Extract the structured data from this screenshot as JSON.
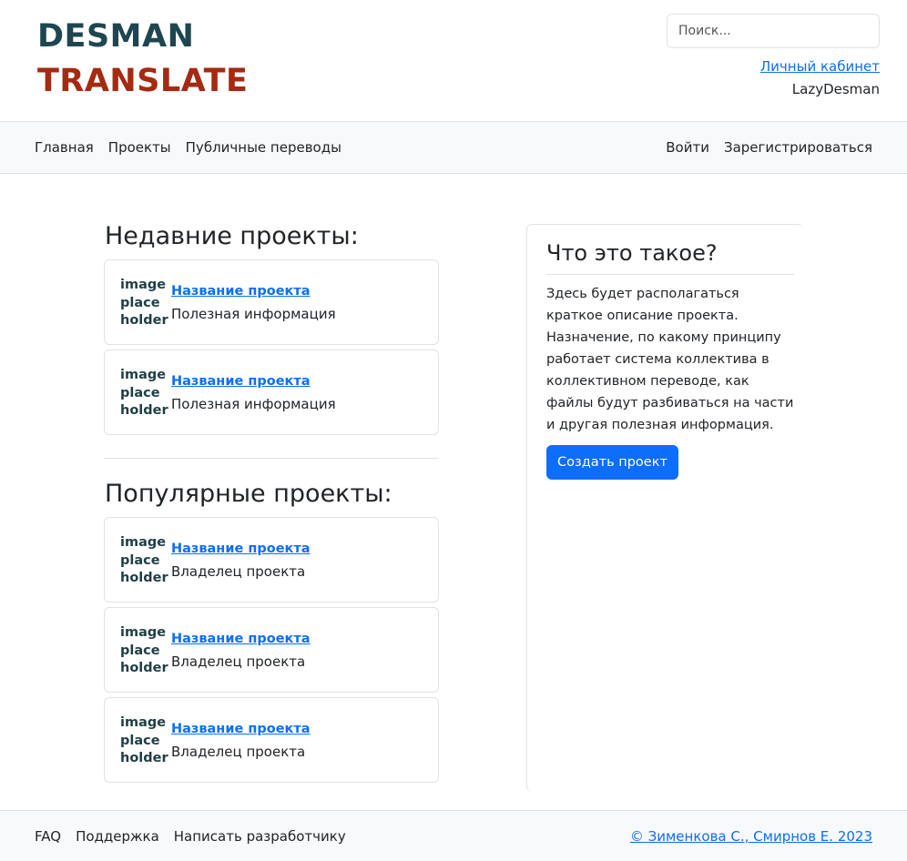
{
  "logo": {
    "line1": "DESMAN",
    "line2": "TRANSLATE"
  },
  "search": {
    "placeholder": "Поиск..."
  },
  "user": {
    "cabinet_link": "Личный кабинет",
    "username": "LazyDesman"
  },
  "nav": {
    "left": [
      "Главная",
      "Проекты",
      "Публичные переводы"
    ],
    "right": [
      "Войти",
      "Зарегистрироваться"
    ]
  },
  "recent": {
    "title": "Недавние проекты:",
    "items": [
      {
        "image": "image place holder",
        "name": "Название проекта",
        "info": "Полезная информация"
      },
      {
        "image": "image place holder",
        "name": "Название проекта",
        "info": "Полезная информация"
      }
    ]
  },
  "popular": {
    "title": "Популярные проекты:",
    "items": [
      {
        "image": "image place holder",
        "name": "Название проекта",
        "info": "Владелец проекта"
      },
      {
        "image": "image place holder",
        "name": "Название проекта",
        "info": "Владелец проекта"
      },
      {
        "image": "image place holder",
        "name": "Название проекта",
        "info": "Владелец проекта"
      }
    ]
  },
  "about": {
    "title": "Что это такое?",
    "text": "Здесь будет располагаться краткое описание проекта. Назначение, по какому принципу работает система коллектива в коллективном переводе, как файлы будут разбиваться на части и другая полезная информация.",
    "button": "Создать проект"
  },
  "footer": {
    "links": [
      "FAQ",
      "Поддержка",
      "Написать разработчику"
    ],
    "copyright": "© Зименкова С., Смирнов Е. 2023"
  },
  "colors": {
    "logo_primary": "#1f4650",
    "logo_accent": "#a52a12",
    "accent": "#0d6efd"
  }
}
